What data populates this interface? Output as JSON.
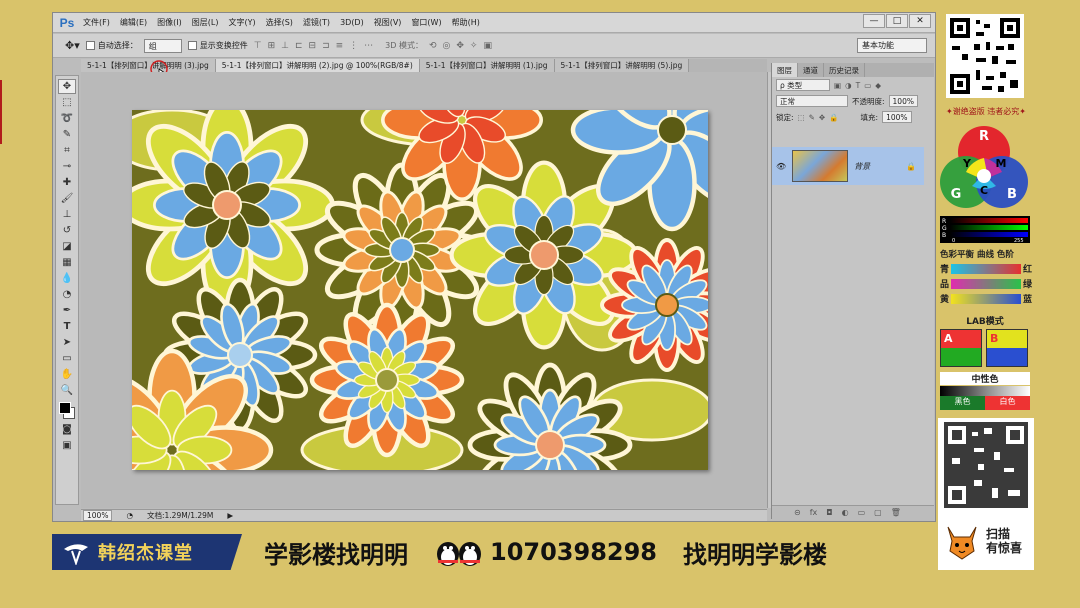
{
  "app": {
    "logo": "Ps",
    "menu": [
      "文件(F)",
      "编辑(E)",
      "图像(I)",
      "图层(L)",
      "文字(Y)",
      "选择(S)",
      "滤镜(T)",
      "3D(D)",
      "视图(V)",
      "窗口(W)",
      "帮助(H)"
    ],
    "window_controls": [
      "—",
      "□",
      "✕"
    ]
  },
  "options": {
    "auto_select_label": "自动选择：",
    "auto_select_value": "组",
    "show_transform_label": "显示变换控件",
    "mode_3d_label": "3D 模式：",
    "workspace": "基本功能"
  },
  "tabs": [
    "5-1-1【排列窗口】讲解明明 (3).jpg",
    "5-1-1【排列窗口】讲解明明 (2).jpg @ 100%(RGB/8#)",
    "5-1-1【排列窗口】讲解明明 (1).jpg",
    "5-1-1【排列窗口】讲解明明 (5).jpg"
  ],
  "status": {
    "zoom": "100%",
    "doc_size": "文档:1.29M/1.29M"
  },
  "layers_panel": {
    "tabs": [
      "图层",
      "通道",
      "历史记录"
    ],
    "filter_label": "ρ 类型",
    "blend_mode": "正常",
    "opacity_label": "不透明度:",
    "opacity_value": "100%",
    "lock_label": "锁定:",
    "fill_label": "填充:",
    "fill_value": "100%",
    "layer_name": "背景"
  },
  "sidebar": {
    "warning": "✦谢绝盗版 违者必究✦",
    "rgb_labels": [
      "R",
      "Y",
      "M",
      "C",
      "G",
      "B"
    ],
    "levels_labels": [
      "R",
      "G",
      "B",
      "0",
      "255"
    ],
    "balance_title": "色彩平衡  曲线  色阶",
    "balance_rows": [
      {
        "left": "青",
        "right": "红"
      },
      {
        "left": "品",
        "right": "绿"
      },
      {
        "left": "黄",
        "right": "蓝"
      }
    ],
    "lab_title": "LAB模式",
    "lab_labels": [
      "A",
      "B"
    ],
    "neutral_title": "中性色",
    "neutral_labels": [
      "黑色",
      "白色"
    ],
    "scan_text": "扫描\n有惊喜"
  },
  "banner": {
    "brand": "韩绍杰课堂",
    "slogan": "学影楼找明明",
    "qq": "1070398298",
    "slogan2": "找明明学影楼"
  },
  "colors": {
    "background": "#d9c36a",
    "brand_navy": "#1d3573",
    "brand_gold": "#f2d25a"
  }
}
